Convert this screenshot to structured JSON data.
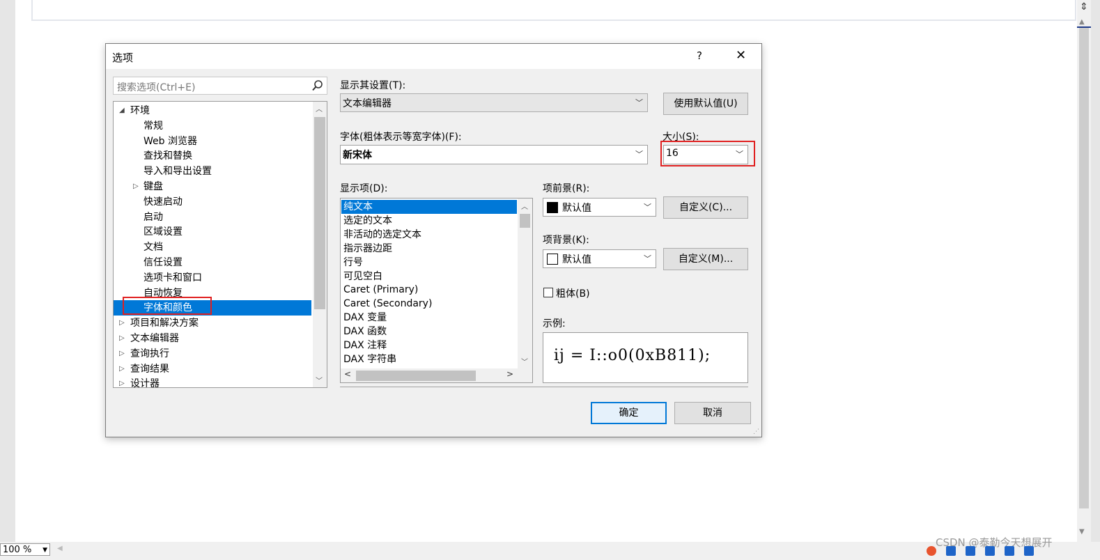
{
  "dialog": {
    "title": "选项",
    "help": "?",
    "close": "✕"
  },
  "search": {
    "placeholder": "搜索选项(Ctrl+E)"
  },
  "tree": [
    {
      "label": "环境",
      "toggle": "◢"
    },
    {
      "label": "常规"
    },
    {
      "label": "Web 浏览器"
    },
    {
      "label": "查找和替换"
    },
    {
      "label": "导入和导出设置"
    },
    {
      "label": "键盘",
      "toggle": "▷"
    },
    {
      "label": "快速启动"
    },
    {
      "label": "启动"
    },
    {
      "label": "区域设置"
    },
    {
      "label": "文档"
    },
    {
      "label": "信任设置"
    },
    {
      "label": "选项卡和窗口"
    },
    {
      "label": "自动恢复"
    },
    {
      "label": "字体和颜色",
      "selected": true
    },
    {
      "label": "项目和解决方案",
      "toggle": "▷"
    },
    {
      "label": "文本编辑器",
      "toggle": "▷"
    },
    {
      "label": "查询执行",
      "toggle": "▷"
    },
    {
      "label": "查询结果",
      "toggle": "▷"
    },
    {
      "label": "设计器",
      "toggle": "▷"
    }
  ],
  "settings": {
    "show_label": "显示其设置(T):",
    "show_value": "文本编辑器",
    "use_defaults": "使用默认值(U)",
    "font_label": "字体(粗体表示等宽字体)(F):",
    "font_value": "新宋体",
    "size_label": "大小(S):",
    "size_value": "16",
    "display_label": "显示项(D):",
    "fg_label": "项前景(R):",
    "fg_value": "默认值",
    "fg_custom": "自定义(C)...",
    "bg_label": "项背景(K):",
    "bg_value": "默认值",
    "bg_custom": "自定义(M)...",
    "bold_label": "粗体(B)",
    "sample_label": "示例:",
    "sample_text": "ij = I::o0(0xB811);",
    "ok": "确定",
    "cancel": "取消"
  },
  "display_items": [
    "纯文本",
    "选定的文本",
    "非活动的选定文本",
    "指示器边距",
    "行号",
    "可见空白",
    "Caret (Primary)",
    "Caret (Secondary)",
    "DAX 变量",
    "DAX 函数",
    "DAX 注释",
    "DAX 字符串"
  ],
  "status": {
    "zoom": "100 %",
    "watermark": "CSDN @泰勒今天想展开"
  },
  "colors": {
    "selection": "#0078d7",
    "highlight_box": "#e02020"
  }
}
